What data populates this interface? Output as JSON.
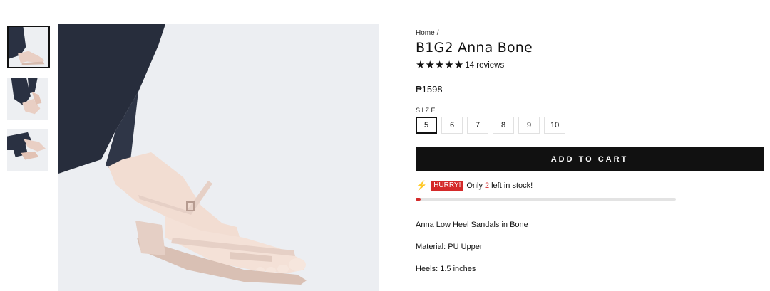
{
  "gallery": {
    "thumbnails": [
      "thumb-1",
      "thumb-2",
      "thumb-3"
    ],
    "active_index": 0
  },
  "breadcrumb": {
    "home": "Home",
    "separator": "/"
  },
  "product": {
    "title": "B1G2 Anna Bone",
    "rating_stars": 5,
    "reviews_text": "14 reviews",
    "price": "₱1598"
  },
  "size": {
    "label": "SIZE",
    "options": [
      "5",
      "6",
      "7",
      "8",
      "9",
      "10"
    ],
    "selected": "5"
  },
  "cart": {
    "label": "ADD TO CART"
  },
  "stock": {
    "hurry_label": "HURRY!",
    "prefix": "Only",
    "count": "2",
    "suffix": "left in stock!",
    "progress_fraction": 0.02
  },
  "description": {
    "line1": "Anna Low Heel Sandals in Bone",
    "line2": "Material: PU Upper",
    "line3": "Heels: 1.5 inches"
  },
  "colors": {
    "accent_red": "#d42a2a",
    "bolt_orange": "#ef6a2c",
    "button_black": "#111111"
  }
}
